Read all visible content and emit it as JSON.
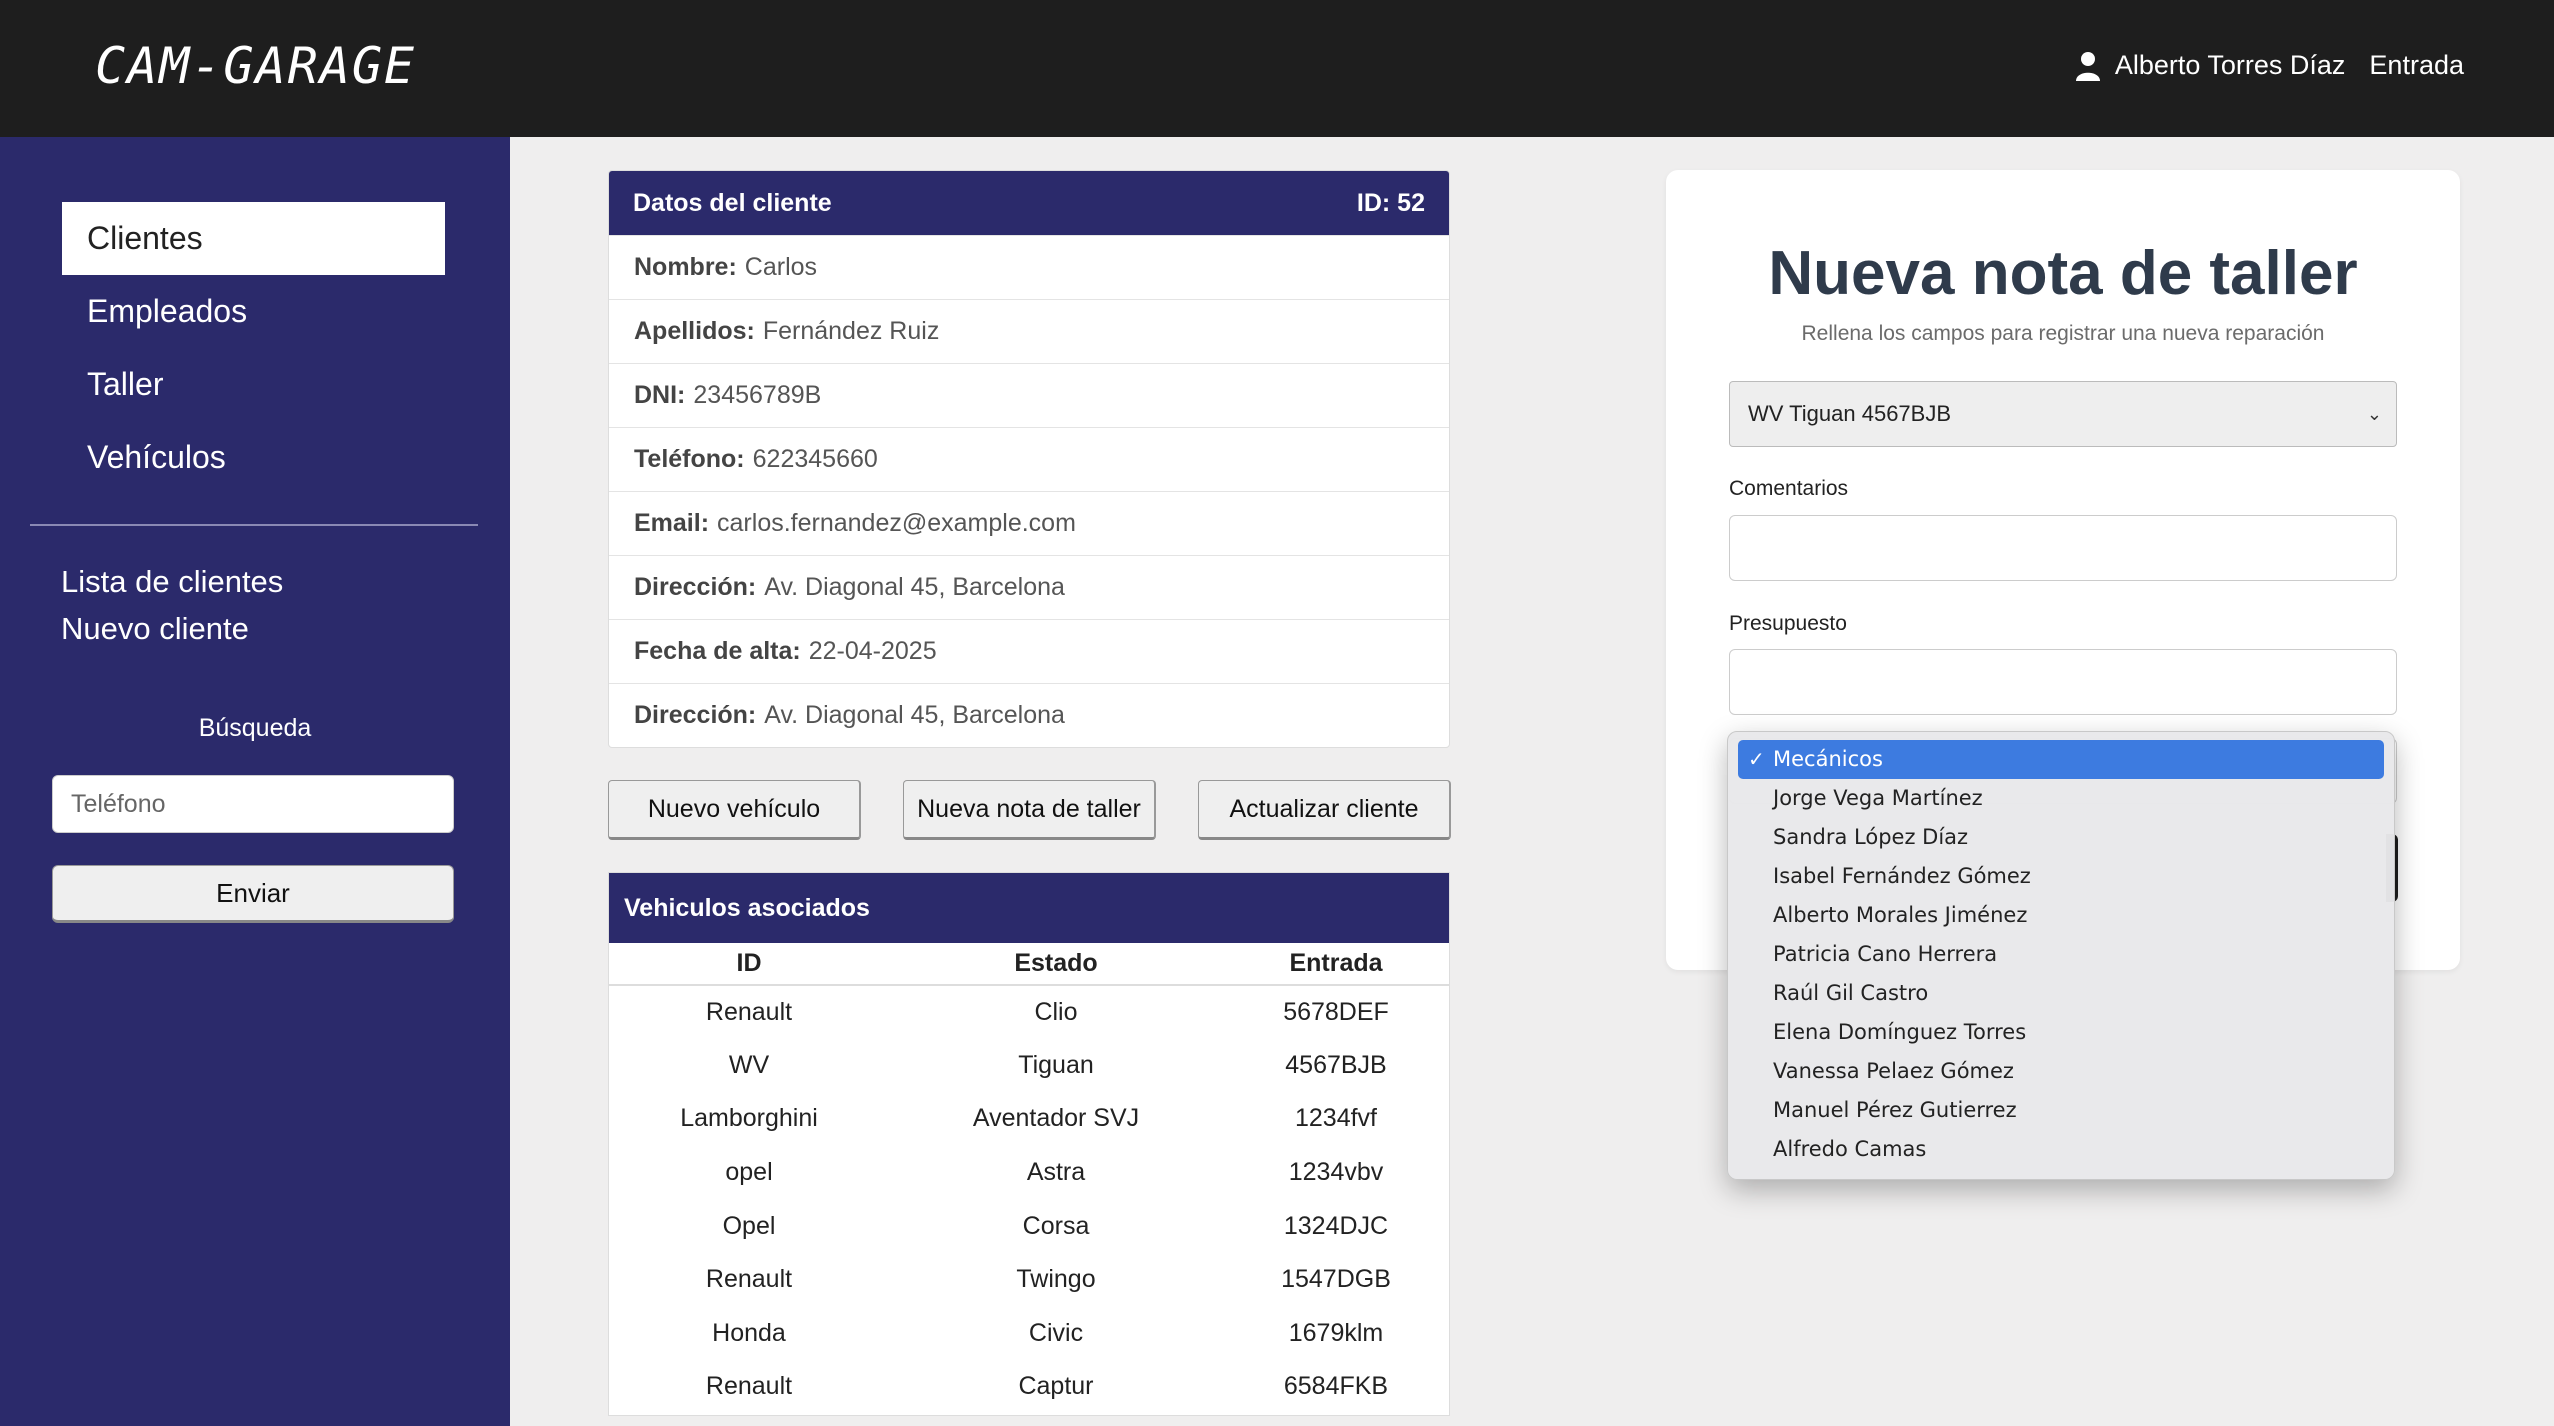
{
  "app": {
    "logo_text": "CAM-GARAGE",
    "user_name": "Alberto Torres Díaz",
    "user_action": "Entrada"
  },
  "sidebar": {
    "nav": [
      {
        "label": "Clientes",
        "active": true
      },
      {
        "label": "Empleados",
        "active": false
      },
      {
        "label": "Taller",
        "active": false
      },
      {
        "label": "Vehículos",
        "active": false
      }
    ],
    "sub_links": [
      "Lista de clientes",
      "Nuevo cliente"
    ],
    "search_label": "Búsqueda",
    "search_placeholder": "Teléfono",
    "submit_label": "Enviar"
  },
  "client": {
    "header_title": "Datos del cliente",
    "header_id": "ID: 52",
    "fields": [
      {
        "label": "Nombre:",
        "value": "Carlos"
      },
      {
        "label": "Apellidos:",
        "value": "Fernández Ruiz"
      },
      {
        "label": "DNI:",
        "value": "23456789B"
      },
      {
        "label": "Teléfono:",
        "value": "622345660"
      },
      {
        "label": "Email:",
        "value": "carlos.fernandez@example.com"
      },
      {
        "label": "Dirección:",
        "value": "Av. Diagonal 45, Barcelona"
      },
      {
        "label": "Fecha de alta:",
        "value": "22-04-2025"
      },
      {
        "label": "Dirección:",
        "value": "Av. Diagonal 45, Barcelona"
      }
    ]
  },
  "actions": {
    "new_vehicle": "Nuevo vehículo",
    "new_note": "Nueva nota de taller",
    "update_client": "Actualizar cliente"
  },
  "vehicles": {
    "title": "Vehiculos asociados",
    "columns": [
      "ID",
      "Estado",
      "Entrada"
    ],
    "rows": [
      [
        "Renault",
        "Clio",
        "5678DEF"
      ],
      [
        "WV",
        "Tiguan",
        "4567BJB"
      ],
      [
        "Lamborghini",
        "Aventador SVJ",
        "1234fvf"
      ],
      [
        "opel",
        "Astra",
        "1234vbv"
      ],
      [
        "Opel",
        "Corsa",
        "1324DJC"
      ],
      [
        "Renault",
        "Twingo",
        "1547DGB"
      ],
      [
        "Honda",
        "Civic",
        "1679klm"
      ],
      [
        "Renault",
        "Captur",
        "6584FKB"
      ]
    ]
  },
  "form": {
    "title": "Nueva nota de taller",
    "subtitle": "Rellena los campos para registrar una nueva reparación",
    "vehicle_selected": "WV Tiguan 4567BJB",
    "comments_label": "Comentarios",
    "budget_label": "Presupuesto",
    "mechanics_options": [
      "Mecánicos",
      "Jorge Vega Martínez",
      "Sandra López Díaz",
      "Isabel Fernández Gómez",
      "Alberto Morales Jiménez",
      "Patricia Cano Herrera",
      "Raúl Gil Castro",
      "Elena Domínguez Torres",
      "Vanessa Pelaez Gómez",
      "Manuel Pérez Gutierrez",
      "Alfredo Camas"
    ],
    "mechanics_selected_index": 0
  },
  "colors": {
    "topbar": "#1e1e1e",
    "sidebar": "#2b2a6b",
    "selected_option": "#3d7be0"
  }
}
